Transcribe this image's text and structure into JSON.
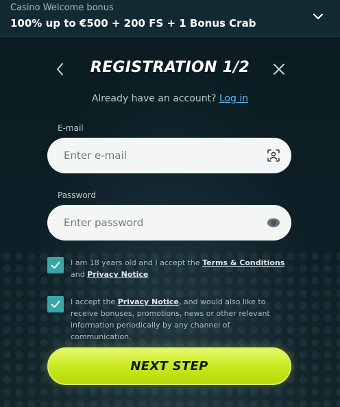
{
  "bonus": {
    "subtitle": "Casino Welcome bonus",
    "headline": "100% up to €500 + 200 FS + 1 Bonus Crab"
  },
  "header": {
    "title": "REGISTRATION 1/2"
  },
  "login": {
    "prompt": "Already have an account?",
    "link": "Log in"
  },
  "email": {
    "label": "E-mail",
    "placeholder": "Enter e-mail",
    "value": ""
  },
  "password": {
    "label": "Password",
    "placeholder": "Enter password",
    "value": ""
  },
  "consents": [
    {
      "checked": true,
      "text_before": "I am 18 years old and I accept the ",
      "link1": "Terms & Conditions",
      "text_middle": " and ",
      "link2": "Privacy Notice",
      "text_after": ""
    },
    {
      "checked": true,
      "text_before": "I accept the ",
      "link1": "Privacy Notice",
      "text_after": ", and would also like to receive bonuses, promotions, news or other relevant information periodically by any channel of communication."
    }
  ],
  "next_button": {
    "label": "NEXT STEP"
  },
  "colors": {
    "accent": "#c7e81a",
    "link": "#5ab8f0",
    "checkbox": "#3aa6a6",
    "background": "#0b1a20"
  },
  "icons": {
    "expand": "chevron-down-icon",
    "back": "chevron-left-icon",
    "close": "close-icon",
    "email_field": "face-scan-icon",
    "password_field": "eye-icon"
  }
}
